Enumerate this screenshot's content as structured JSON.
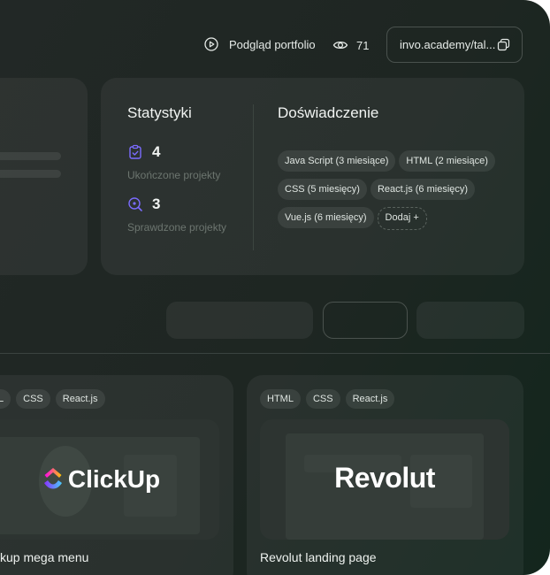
{
  "header": {
    "preview_label": "Podgląd portfolio",
    "views_count": "71",
    "url_text": "invo.academy/tal..."
  },
  "stats": {
    "title": "Statystyki",
    "completed": {
      "count": "4",
      "label": "Ukończone projekty"
    },
    "checked": {
      "count": "3",
      "label": "Sprawdzone projekty"
    }
  },
  "experience": {
    "title": "Doświadczenie",
    "chips": [
      "Java Script (3 miesiące)",
      "HTML (2 miesiące)",
      "CSS (5 miesięcy)",
      "React.js (6 miesięcy)",
      "Vue.js (6 miesięcy)"
    ],
    "add_label": "Dodaj +"
  },
  "projects": [
    {
      "tags": [
        "L",
        "CSS",
        "React.js"
      ],
      "brand": "ClickUp",
      "title": "kup mega menu"
    },
    {
      "tags": [
        "HTML",
        "CSS",
        "React.js"
      ],
      "brand": "Revolut",
      "title": "Revolut landing page"
    }
  ],
  "colors": {
    "background": "#1e2622",
    "accent_purple": "#7b6cff",
    "clickup_pink": "#f64fa0",
    "clickup_blue": "#49ccf9"
  }
}
